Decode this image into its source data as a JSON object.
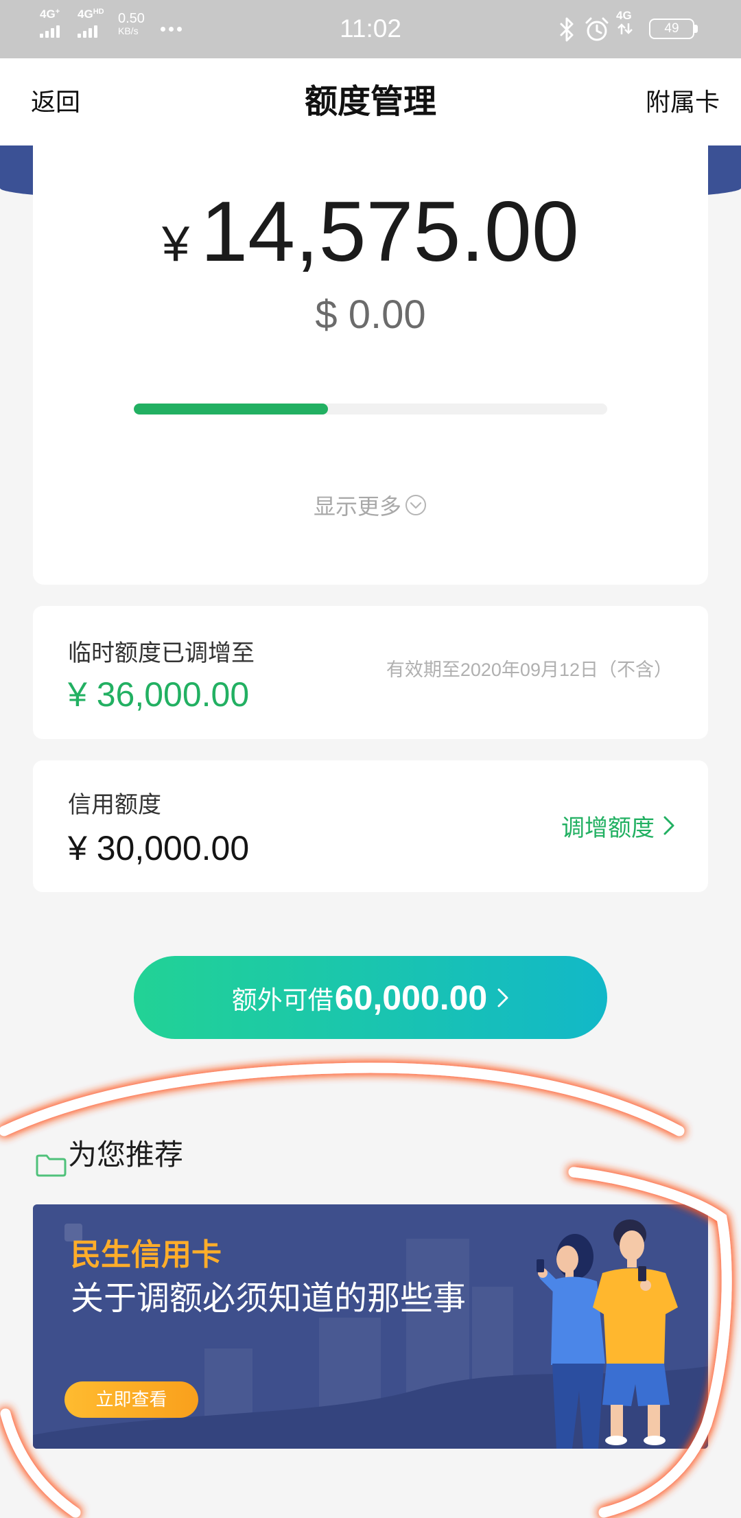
{
  "status_bar": {
    "sim1": {
      "label": "4G",
      "sup": "+"
    },
    "sim2": {
      "label": "4G",
      "sup": "HD"
    },
    "net_speed": {
      "value": "0.50",
      "unit": "KB/s"
    },
    "time": "11:02",
    "network": {
      "label": "4G"
    },
    "battery": "49",
    "icons": [
      "signal-bars-icon",
      "more-dots-icon",
      "bluetooth-icon",
      "alarm-icon",
      "data-arrows-icon",
      "battery-icon"
    ]
  },
  "header": {
    "back": "返回",
    "title": "额度管理",
    "right": "附属卡"
  },
  "summary": {
    "currency": "¥",
    "amount": "14,575.00",
    "usd_amount": "$ 0.00",
    "progress": 0.41,
    "show_more": "显示更多"
  },
  "temp_limit": {
    "label": "临时额度已调增至",
    "amount": "¥ 36,000.00",
    "validity": "有效期至2020年09月12日（不含）"
  },
  "credit_limit": {
    "label": "信用额度",
    "amount": "¥ 30,000.00",
    "action": "调增额度"
  },
  "extra_loan": {
    "prefix": "额外可借",
    "amount": "60,000.00"
  },
  "recommend": {
    "title": "为您推荐",
    "banner": {
      "brand": "民生信用卡",
      "headline": "关于调额必须知道的那些事",
      "cta": "立即查看"
    }
  },
  "colors": {
    "accent_green": "#22b062",
    "header_navy": "#3b5195",
    "banner_navy": "#3e4f8c",
    "cta_orange": "#ffad2a",
    "button_gradient_start": "#22d295",
    "button_gradient_end": "#12b8c8"
  }
}
